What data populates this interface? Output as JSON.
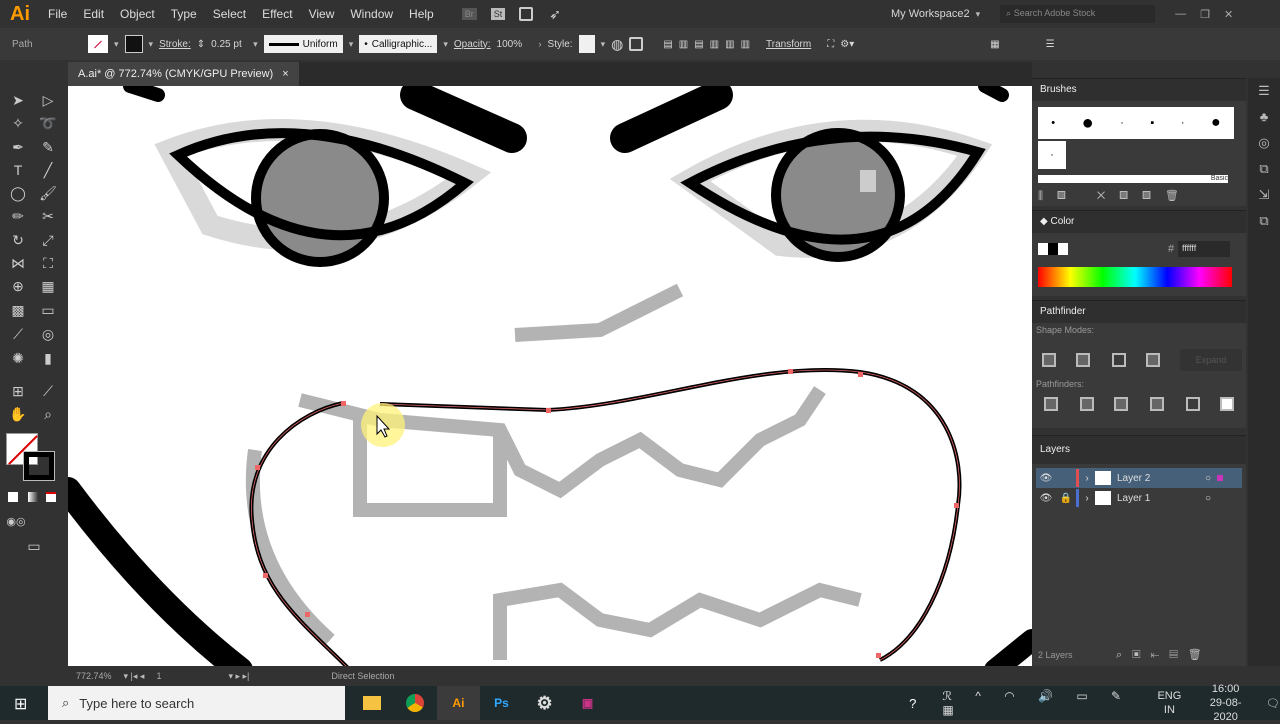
{
  "app": {
    "logo": "Ai",
    "menu": [
      "File",
      "Edit",
      "Object",
      "Type",
      "Select",
      "Effect",
      "View",
      "Window",
      "Help"
    ],
    "bridge": "Br",
    "stock": "St",
    "workspace": "My Workspace2",
    "search_placeholder": "Search Adobe Stock"
  },
  "control": {
    "selection": "Path",
    "stroke_label": "Stroke:",
    "stroke_weight": "0.25 pt",
    "profile": "Uniform",
    "brush": "Calligraphic...",
    "opacity_label": "Opacity:",
    "opacity": "100%",
    "style_label": "Style:",
    "transform": "Transform"
  },
  "document": {
    "tab": "A.ai* @ 772.74% (CMYK/GPU Preview)",
    "close": "×"
  },
  "status": {
    "zoom": "772.74%",
    "artboard": "1",
    "tool": "Direct Selection"
  },
  "panels": {
    "brushes": {
      "title": "Brushes",
      "library": "Basic"
    },
    "color": {
      "title": "Color",
      "hex_label": "#",
      "hex": "ffffff"
    },
    "pathfinder": {
      "title": "Pathfinder",
      "shape_modes": "Shape Modes:",
      "expand": "Expand",
      "pathfinders": "Pathfinders:"
    },
    "layers": {
      "title": "Layers",
      "items": [
        {
          "name": "Layer 2",
          "color": "#e05050",
          "selected": true
        },
        {
          "name": "Layer 1",
          "color": "#4a6fd0",
          "locked": true
        }
      ],
      "count": "2 Layers"
    }
  },
  "taskbar": {
    "search": "Type here to search",
    "lang1": "ENG",
    "lang2": "IN",
    "time": "16:00",
    "date": "29-08-2020"
  }
}
